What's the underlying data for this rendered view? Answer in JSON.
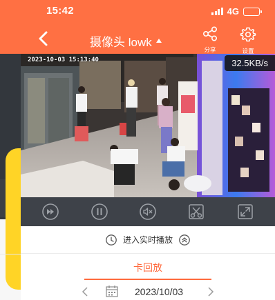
{
  "status_bar": {
    "time": "15:42",
    "network": "4G"
  },
  "header": {
    "title": "摄像头 lowk",
    "share_label": "分享",
    "settings_label": "设置"
  },
  "video": {
    "timestamp": "2023-10-03 15:13:40",
    "speed": "32.5KB/s"
  },
  "controls": [
    {
      "name": "fast-forward-icon"
    },
    {
      "name": "pause-icon"
    },
    {
      "name": "mute-icon"
    },
    {
      "name": "screenshot-scissors-icon"
    },
    {
      "name": "fullscreen-icon"
    }
  ],
  "live": {
    "label": "进入实时播放"
  },
  "playback": {
    "tab_label": "卡回放",
    "date": "2023/10/03"
  },
  "colors": {
    "accent": "#ff7043",
    "tab_accent": "#ff6a3d",
    "controls_bg": "#3e4249"
  }
}
